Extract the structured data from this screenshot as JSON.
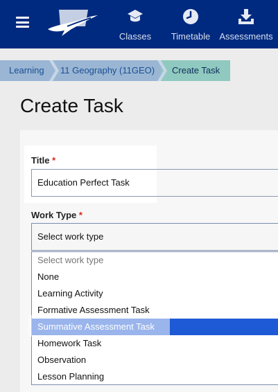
{
  "nav": {
    "items": [
      {
        "label": "Classes",
        "icon": "graduation-cap-icon"
      },
      {
        "label": "Timetable",
        "icon": "clock-icon"
      },
      {
        "label": "Assessments",
        "icon": "download-tray-icon"
      }
    ]
  },
  "breadcrumb": {
    "items": [
      "Learning",
      "11 Geography (11GEO)",
      "Create Task"
    ]
  },
  "page_title": "Create Task",
  "form": {
    "title_label": "Title",
    "title_value": "Education Perfect Task",
    "work_type_label": "Work Type",
    "required_mark": "*",
    "work_type_selected": "Select work type",
    "work_type_options": [
      "Select work type",
      "None",
      "Learning Activity",
      "Formative Assessment Task",
      "Summative Assessment Task",
      "Homework Task",
      "Observation",
      "Lesson Planning"
    ],
    "highlighted_option": "Summative Assessment Task"
  },
  "colors": {
    "nav_bg": "#002a7f",
    "crumb_bg": "#9ab6d4",
    "crumb_active_bg": "#8fc9bf",
    "selected_option_bg": "#1f5ad6",
    "required": "#d9261c"
  }
}
